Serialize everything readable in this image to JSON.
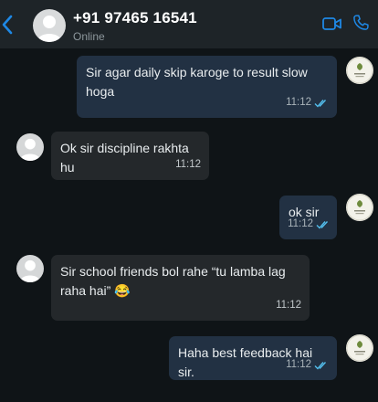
{
  "header": {
    "contact_name": "+91 97465 16541",
    "status": "Online"
  },
  "icons": {
    "back": "chevron-left-icon",
    "video": "video-call-icon",
    "call": "phone-icon",
    "accent": "#1e88e5"
  },
  "messages": [
    {
      "direction": "outgoing",
      "text": "Sir agar daily skip karoge to result slow hoga",
      "time": "11:12",
      "read": true
    },
    {
      "direction": "incoming",
      "text": "Ok sir discipline rakhta hu",
      "time": "11:12"
    },
    {
      "direction": "outgoing",
      "text": "ok sir",
      "time": "11:12",
      "read": true
    },
    {
      "direction": "incoming",
      "text": "Sir school friends bol rahe “tu lamba lag raha hai” 😂",
      "time": "11:12"
    },
    {
      "direction": "outgoing",
      "text": "Haha best feedback hai sir.",
      "time": "11:12",
      "read": true
    }
  ],
  "colors": {
    "outgoing_bubble": "#223143",
    "incoming_bubble": "#24282b",
    "read_ticks": "#53bdeb"
  }
}
